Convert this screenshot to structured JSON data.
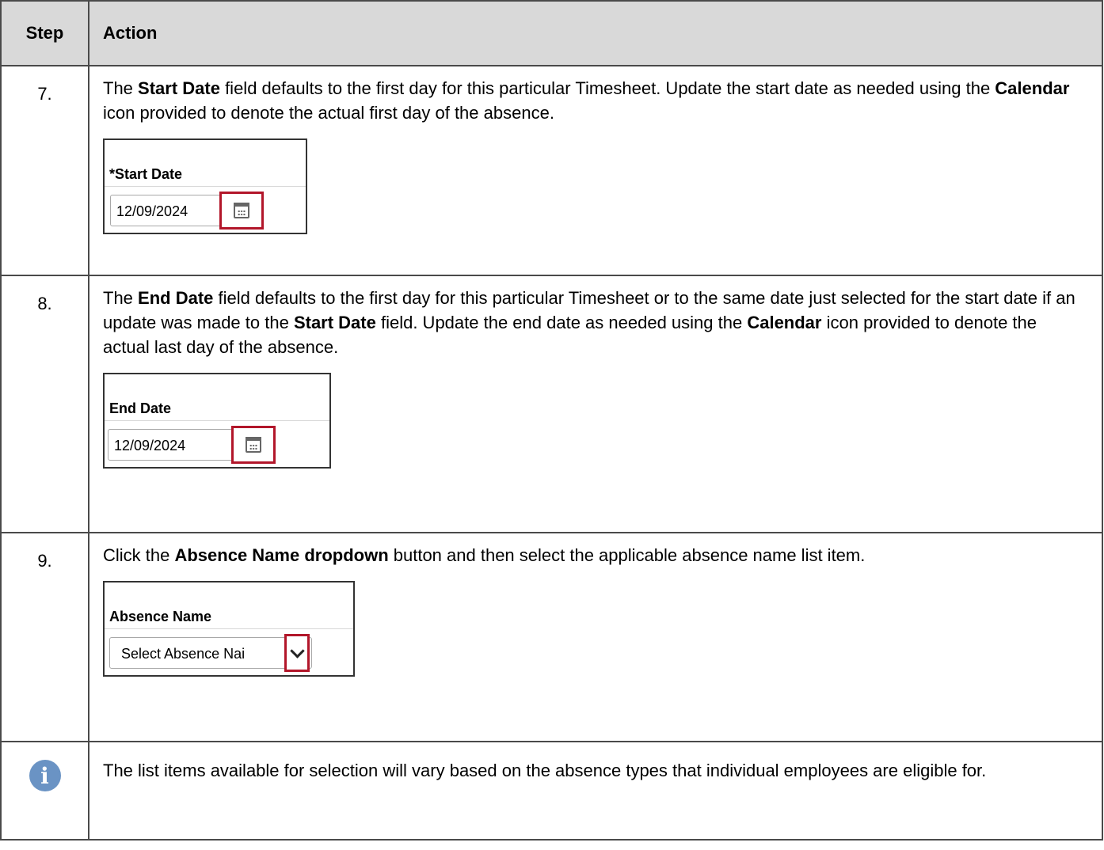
{
  "header": {
    "step": "Step",
    "action": "Action"
  },
  "rows": [
    {
      "num": "7.",
      "text_parts": [
        "The ",
        "Start Date",
        " field defaults to the first day for this particular Timesheet.  Update the start date as needed using the ",
        "Calendar",
        " icon provided to denote the actual first day of the absence."
      ],
      "shot": {
        "label": "*Start Date",
        "value": "12/09/2024",
        "icon": "calendar-icon"
      }
    },
    {
      "num": "8.",
      "text_parts": [
        "The ",
        "End Date",
        " field defaults to the first day for this particular Timesheet or to the same date just selected for the start date if an update was made to the ",
        "Start Date",
        " field.  Update the end date as needed using the ",
        "Calendar",
        " icon provided to denote the actual last day of the absence."
      ],
      "shot": {
        "label": "End Date",
        "value": "12/09/2024",
        "icon": "calendar-icon"
      }
    },
    {
      "num": "9.",
      "text_parts": [
        "Click the ",
        "Absence Name dropdown",
        " button and then select the applicable absence name list item."
      ],
      "shot": {
        "label": "Absence Name",
        "value": "Select Absence Nai",
        "icon": "chevron-down-icon"
      }
    }
  ],
  "note": {
    "icon": "info-icon",
    "icon_glyph": "i",
    "text": "The list items available for selection will vary based on the absence types that individual employees are eligible for."
  },
  "colors": {
    "highlight": "#b2162a",
    "header_bg": "#d9d9d9",
    "info_icon": "#6a93c4"
  }
}
